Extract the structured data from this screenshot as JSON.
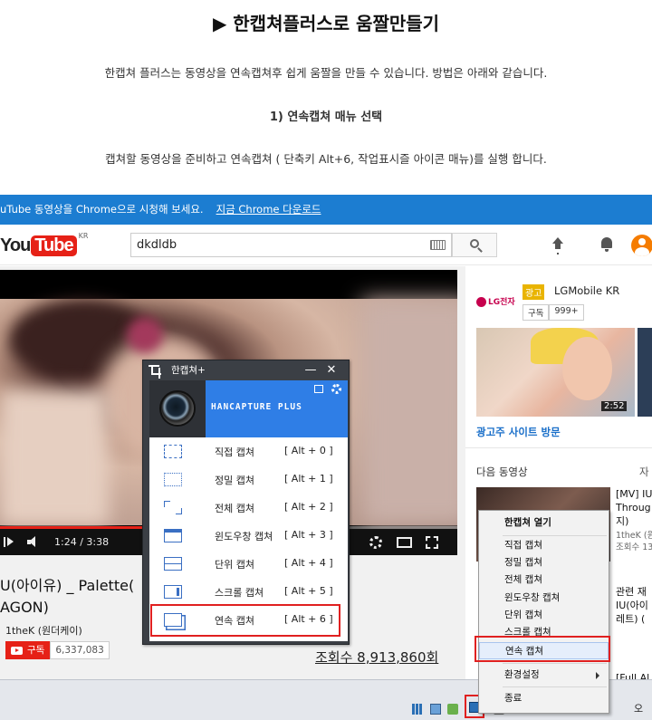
{
  "blog": {
    "title": "▶ 한캡쳐플러스로 움짤만들기",
    "intro": "한캡쳐 플러스는 동영상을 연속캡쳐후 쉽게 움짤을 만들 수 있습니다. 방법은 아래와 같습니다.",
    "step1": "1) 연속캡쳐 매뉴 선택",
    "instruction": "캡쳐할 동영상을 준비하고 연속캡쳐 ( 단축키 Alt+6, 작업표시즐 아이콘 매뉴)를  실행 합니다."
  },
  "chrome_bar": {
    "message": "uTube 동영상을 Chrome으로 시청해 보세요.",
    "link": "지금 Chrome 다운로드"
  },
  "youtube": {
    "logo_you": "You",
    "logo_tube": "Tube",
    "logo_region": "KR",
    "search_value": "dkdldb",
    "player": {
      "time": "1:24 / 3:38",
      "progress": 0.385
    },
    "video_title_line1": "U(아이유) _ Palette(",
    "video_title_line2": "AGON)",
    "channel": "1theK (원더케이)",
    "subscribe_label": "구독",
    "subscriber_count": "6,337,083",
    "views": "조회수 8,913,860회",
    "sidebar": {
      "ad_logo": "LG전자",
      "ad_badge": "광고",
      "ad_name": "LGMobile KR",
      "ad_subscribe": "구독",
      "ad_sub_count": "999+",
      "ad_duration": "2:52",
      "ad_link": "광고주 사이트 방문",
      "next_label": "다음 동영상",
      "autoplay_label": "자",
      "rel1_line1": "[MV] IU",
      "rel1_line2": "Throug",
      "rel1_line3": "지)",
      "rel1_channel": "1theK (원",
      "rel1_views": "조회수 13",
      "rel2_line1": "관련 재",
      "rel2_line2": "IU(아이",
      "rel2_line3": "레트) (",
      "rel3_line1": "[Full Al"
    }
  },
  "hancapture": {
    "window_title": "한캡쳐+",
    "minimize": "—",
    "close": "✕",
    "brand": "HANCAPTURE PLUS",
    "menu": [
      {
        "label": "직접 캡쳐",
        "shortcut": "[ Alt + 0 ]"
      },
      {
        "label": "정밀 캡쳐",
        "shortcut": "[ Alt + 1 ]"
      },
      {
        "label": "전체 캡쳐",
        "shortcut": "[ Alt + 2 ]"
      },
      {
        "label": "윈도우창 캡쳐",
        "shortcut": "[ Alt + 3 ]"
      },
      {
        "label": "단위 캡쳐",
        "shortcut": "[ Alt + 4 ]"
      },
      {
        "label": "스크롤 캡쳐",
        "shortcut": "[ Alt + 5 ]"
      },
      {
        "label": "연속 캡쳐",
        "shortcut": "[ Alt + 6 ]"
      }
    ]
  },
  "tray_menu": {
    "open": "한캡쳐 열기",
    "items": [
      "직접 캡쳐",
      "정밀 캡쳐",
      "전체 캡쳐",
      "윈도우창 캡쳐",
      "단위 캡쳐",
      "스크롤 캡쳐",
      "연속 캡쳐"
    ],
    "settings": "환경설정",
    "exit": "종료"
  },
  "taskbar": {
    "clock": "오"
  },
  "colors": {
    "chrome_bar": "#1c7dd1",
    "youtube_red": "#e62117",
    "hancapture_blue": "#2f7ee6",
    "highlight_red": "#e02020"
  }
}
